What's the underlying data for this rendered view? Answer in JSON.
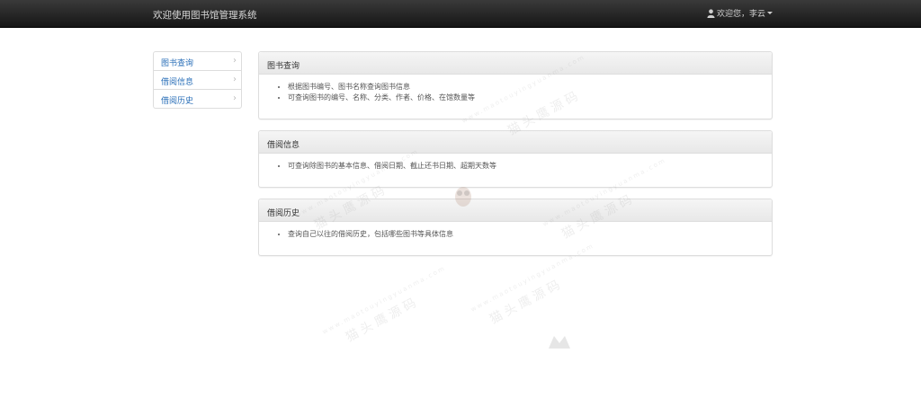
{
  "header": {
    "title": "欢迎使用图书馆管理系统",
    "user_greeting": "欢迎您，李云"
  },
  "sidebar": {
    "items": [
      {
        "label": "图书查询",
        "icon": "chevron-right-icon"
      },
      {
        "label": "借阅信息",
        "icon": "chevron-right-icon"
      },
      {
        "label": "借阅历史",
        "icon": "chevron-right-icon"
      }
    ]
  },
  "panels": [
    {
      "title": "图书查询",
      "items": [
        "根据图书编号、图书名称查询图书信息",
        "可查询图书的编号、名称、分类、作者、价格、在馆数量等"
      ]
    },
    {
      "title": "借阅信息",
      "items": [
        "可查询除图书的基本信息、借阅日期、截止还书日期、超期天数等"
      ]
    },
    {
      "title": "借阅历史",
      "items": [
        "查询自己以往的借阅历史，包括哪些图书等具体信息"
      ]
    }
  ],
  "watermark": {
    "text": "猫头鹰源码",
    "url": "www.maotouyingyuanma.com"
  },
  "colors": {
    "navbar_dark": "#1f1f1f",
    "link_blue": "#2a6fb8",
    "border": "#dddddd"
  }
}
